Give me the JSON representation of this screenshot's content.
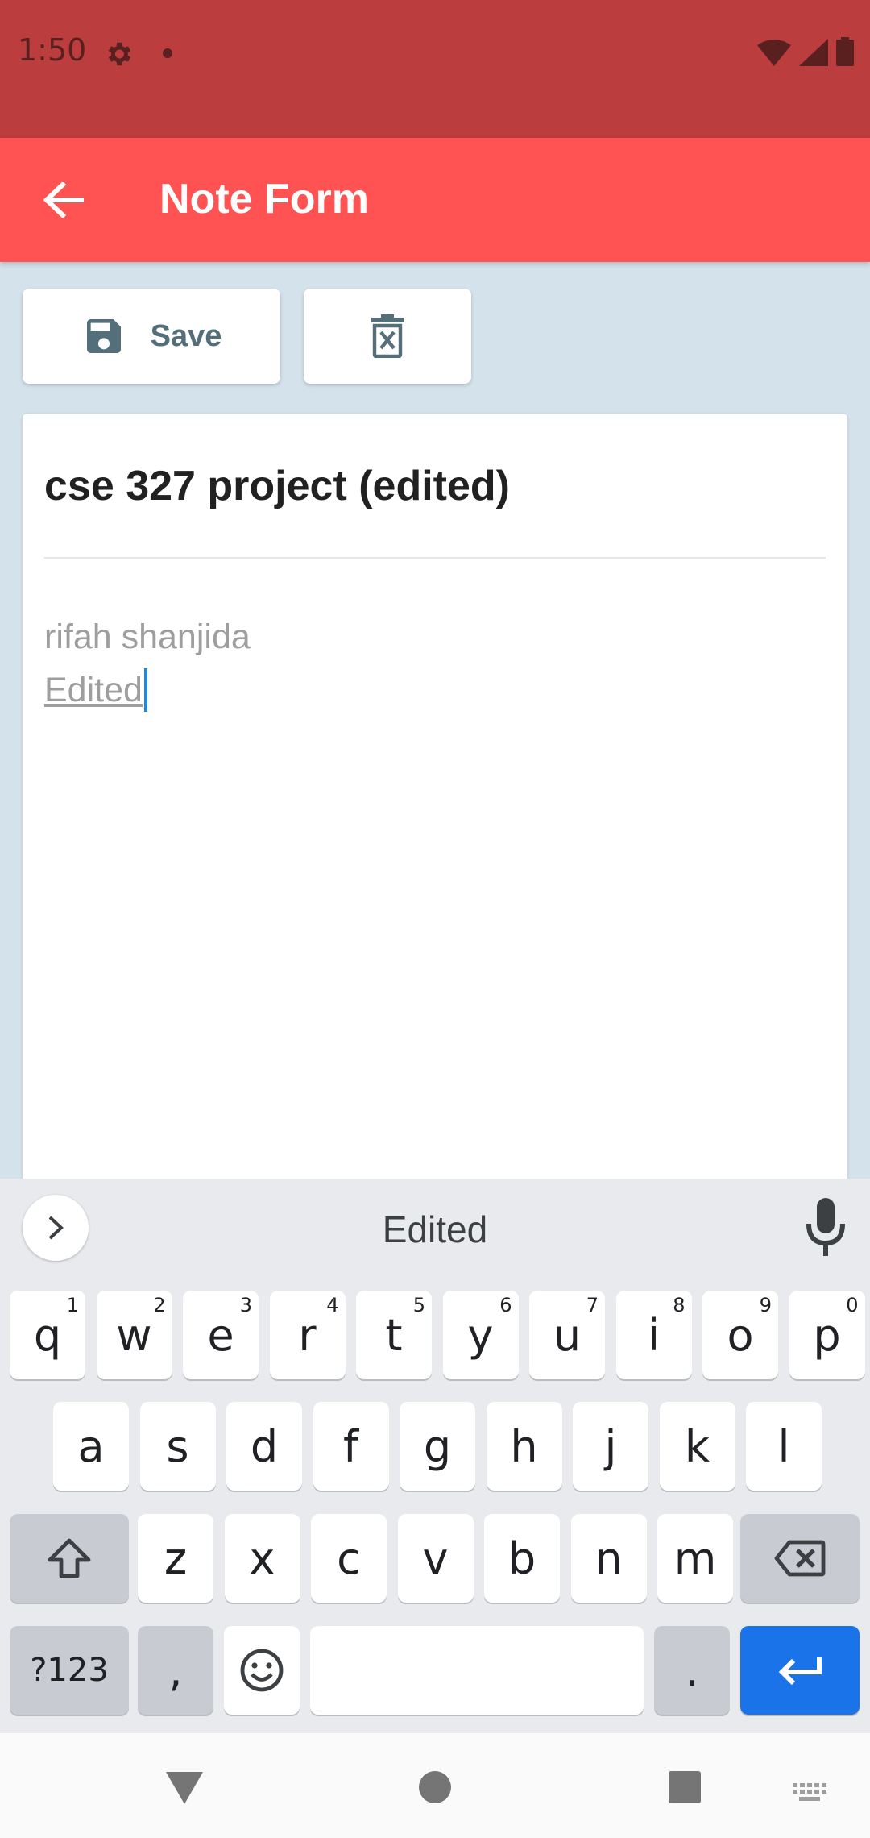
{
  "status_bar": {
    "time": "1:50"
  },
  "app_bar": {
    "title": "Note Form"
  },
  "toolbar": {
    "save_label": "Save"
  },
  "note": {
    "title": "cse 327 project (edited)",
    "body_line1": "rifah shanjida",
    "body_line2": "Edited"
  },
  "keyboard": {
    "suggestion": "Edited",
    "row1": [
      {
        "label": "q",
        "hint": "1"
      },
      {
        "label": "w",
        "hint": "2"
      },
      {
        "label": "e",
        "hint": "3"
      },
      {
        "label": "r",
        "hint": "4"
      },
      {
        "label": "t",
        "hint": "5"
      },
      {
        "label": "y",
        "hint": "6"
      },
      {
        "label": "u",
        "hint": "7"
      },
      {
        "label": "i",
        "hint": "8"
      },
      {
        "label": "o",
        "hint": "9"
      },
      {
        "label": "p",
        "hint": "0"
      }
    ],
    "row2": [
      "a",
      "s",
      "d",
      "f",
      "g",
      "h",
      "j",
      "k",
      "l"
    ],
    "row3": [
      "z",
      "x",
      "c",
      "v",
      "b",
      "n",
      "m"
    ],
    "symbols_label": "?123",
    "comma_label": ",",
    "period_label": "."
  },
  "colors": {
    "status_bar": "#bb3d3d",
    "app_bar": "#ff5252",
    "enter_key": "#1a73e8",
    "background": "#d4e2eb"
  }
}
